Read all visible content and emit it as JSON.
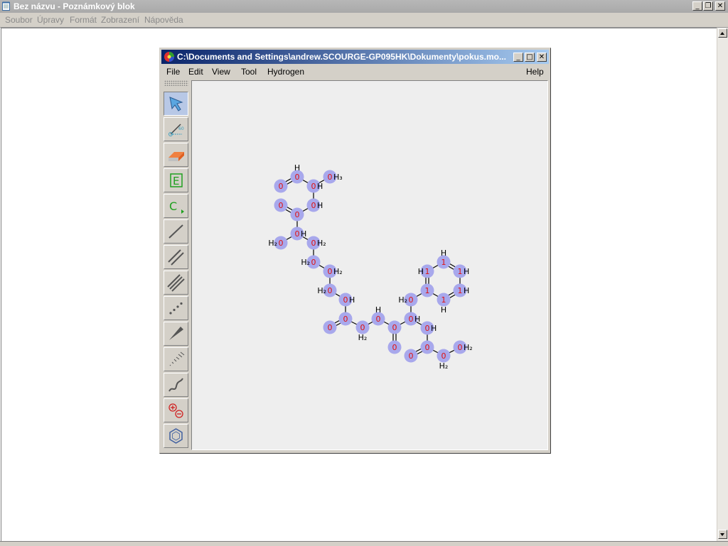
{
  "notepad": {
    "title": "Bez názvu - Poznámkový blok",
    "menu": [
      "Soubor",
      "Úpravy",
      "Formát",
      "Zobrazení",
      "Nápověda"
    ]
  },
  "window_controls": [
    "minimize-icon",
    "restore-icon",
    "close-icon"
  ],
  "jchem": {
    "title": "C:\\Documents and Settings\\andrew.SCOURGE-GP095HK\\Dokumenty\\pokus.mo...",
    "menu": [
      "File",
      "Edit",
      "View",
      "Tool",
      "Hydrogen"
    ],
    "help": "Help",
    "tools": [
      "select-arrow-icon",
      "rotate-angle-icon",
      "eraser-icon",
      "element-e-icon",
      "carbon-chain-icon",
      "single-bond-icon",
      "double-bond-icon",
      "triple-bond-icon",
      "dotted-bond-icon",
      "wedge-bond-icon",
      "hashed-bond-icon",
      "wavy-bond-icon",
      "charge-plus-minus-icon",
      "benzene-ring-icon"
    ]
  },
  "molecule": {
    "atoms": [
      {
        "id": "a0",
        "label": "0",
        "h": "H",
        "hpos": "above"
      },
      {
        "id": "a1",
        "label": "0",
        "h": "H₃",
        "hpos": "right"
      },
      {
        "id": "a2",
        "label": "0",
        "h": "",
        "hpos": ""
      },
      {
        "id": "a3",
        "label": "0",
        "h": "H",
        "hpos": "right"
      },
      {
        "id": "a4",
        "label": "0",
        "h": "",
        "hpos": ""
      },
      {
        "id": "a5",
        "label": "0",
        "h": "",
        "hpos": ""
      },
      {
        "id": "a6",
        "label": "0",
        "h": "H",
        "hpos": "right"
      },
      {
        "id": "a7",
        "label": "0",
        "h": "H",
        "hpos": "right"
      },
      {
        "id": "a8",
        "label": "0",
        "h": "H₂",
        "hpos": "left"
      },
      {
        "id": "a9",
        "label": "0",
        "h": "H₂",
        "hpos": "right"
      },
      {
        "id": "a10",
        "label": "0",
        "h": "H₂",
        "hpos": "left"
      },
      {
        "id": "a11",
        "label": "0",
        "h": "H₂",
        "hpos": "right"
      },
      {
        "id": "a12",
        "label": "0",
        "h": "H₂",
        "hpos": "left"
      },
      {
        "id": "a13",
        "label": "0",
        "h": "H",
        "hpos": "right"
      },
      {
        "id": "a14",
        "label": "0",
        "h": "",
        "hpos": ""
      },
      {
        "id": "a15",
        "label": "0",
        "h": "",
        "hpos": ""
      },
      {
        "id": "a16",
        "label": "0",
        "h": "H₂",
        "hpos": "below"
      },
      {
        "id": "a17",
        "label": "0",
        "h": "H",
        "hpos": "above"
      },
      {
        "id": "a18",
        "label": "0",
        "h": "",
        "hpos": ""
      },
      {
        "id": "a19",
        "label": "0",
        "h": "",
        "hpos": ""
      },
      {
        "id": "a20",
        "label": "0",
        "h": "H",
        "hpos": "right"
      },
      {
        "id": "a21",
        "label": "0",
        "h": "H",
        "hpos": "right"
      },
      {
        "id": "a22",
        "label": "0",
        "h": "",
        "hpos": ""
      },
      {
        "id": "a23",
        "label": "0",
        "h": "",
        "hpos": ""
      },
      {
        "id": "a24",
        "label": "0",
        "h": "H₂",
        "hpos": "below"
      },
      {
        "id": "a25",
        "label": "0",
        "h": "H₂",
        "hpos": "right"
      },
      {
        "id": "a26",
        "label": "0",
        "h": "H₂",
        "hpos": "left"
      },
      {
        "id": "a27",
        "label": "1",
        "h": "",
        "hpos": ""
      },
      {
        "id": "a28",
        "label": "1",
        "h": "H",
        "hpos": "left"
      },
      {
        "id": "a29",
        "label": "1",
        "h": "H",
        "hpos": "above"
      },
      {
        "id": "a30",
        "label": "1",
        "h": "H",
        "hpos": "right"
      },
      {
        "id": "a31",
        "label": "1",
        "h": "H",
        "hpos": "right"
      },
      {
        "id": "a32",
        "label": "1",
        "h": "H",
        "hpos": "below"
      }
    ],
    "bonds": [
      [
        "a0",
        "a2",
        2
      ],
      [
        "a0",
        "a3",
        1
      ],
      [
        "a3",
        "a1",
        1
      ],
      [
        "a3",
        "a6",
        1
      ],
      [
        "a6",
        "a5",
        1
      ],
      [
        "a5",
        "a4",
        2
      ],
      [
        "a5",
        "a7",
        1
      ],
      [
        "a7",
        "a8",
        1
      ],
      [
        "a7",
        "a9",
        1
      ],
      [
        "a9",
        "a10",
        1
      ],
      [
        "a10",
        "a11",
        1
      ],
      [
        "a11",
        "a12",
        1
      ],
      [
        "a12",
        "a13",
        1
      ],
      [
        "a13",
        "a15",
        1
      ],
      [
        "a15",
        "a14",
        2
      ],
      [
        "a15",
        "a16",
        1
      ],
      [
        "a16",
        "a17",
        1
      ],
      [
        "a17",
        "a18",
        1
      ],
      [
        "a18",
        "a19",
        2
      ],
      [
        "a18",
        "a20",
        1
      ],
      [
        "a20",
        "a26",
        1
      ],
      [
        "a20",
        "a21",
        1
      ],
      [
        "a21",
        "a23",
        1
      ],
      [
        "a23",
        "a22",
        2
      ],
      [
        "a23",
        "a24",
        1
      ],
      [
        "a24",
        "a25",
        1
      ],
      [
        "a26",
        "a27",
        1
      ],
      [
        "a27",
        "a28",
        2
      ],
      [
        "a28",
        "a29",
        1
      ],
      [
        "a29",
        "a30",
        2
      ],
      [
        "a30",
        "a31",
        1
      ],
      [
        "a31",
        "a32",
        2
      ],
      [
        "a32",
        "a27",
        1
      ]
    ]
  }
}
